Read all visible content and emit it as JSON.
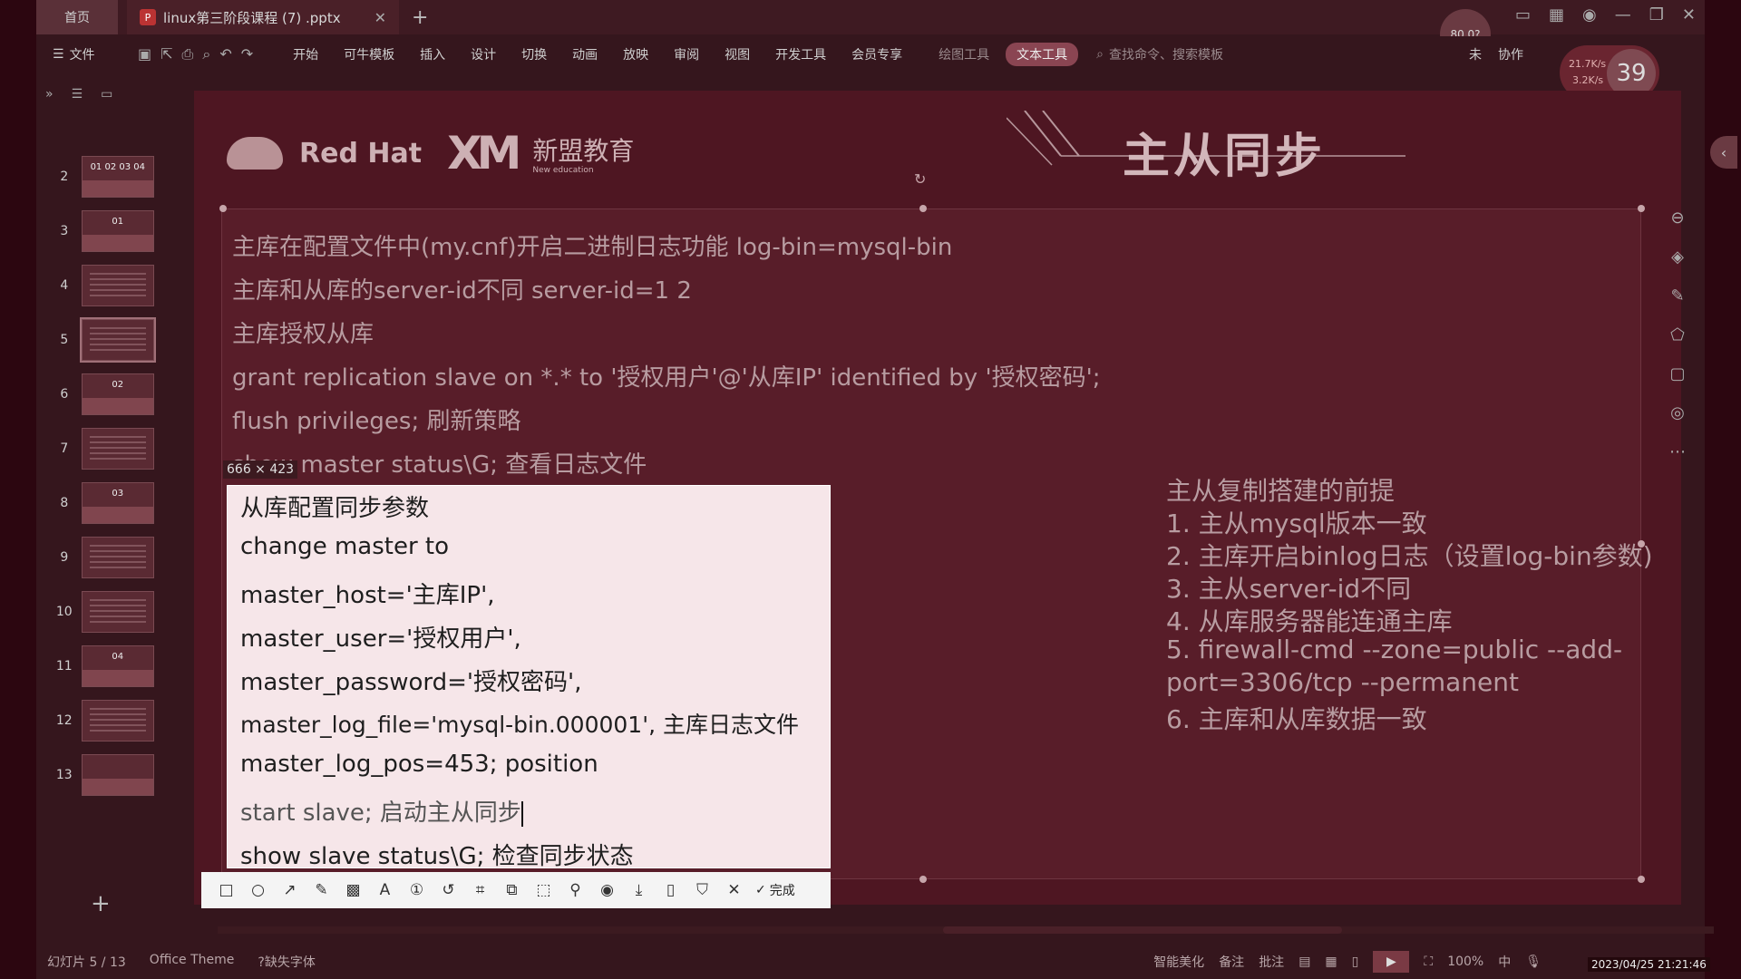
{
  "titlebar": {
    "home_tab": "首页",
    "doc_tab": "linux第三阶段课程 (7) .pptx",
    "close": "✕",
    "plus": "+",
    "speed_text": "80.0?"
  },
  "menubar": {
    "file": "文件",
    "menu_items": [
      "开始",
      "可牛模板",
      "插入",
      "设计",
      "切换",
      "动画",
      "放映",
      "审阅",
      "视图",
      "开发工具",
      "会员专享"
    ],
    "drawing_tools": "绘图工具",
    "text_tools": "文本工具",
    "search": "查找命令、搜索模板",
    "right_items": [
      "未",
      "协作"
    ]
  },
  "perf": {
    "up": "21.7K/s",
    "down": "3.2K/s",
    "percent": "39"
  },
  "thumbnails": [
    {
      "num": "2",
      "caption": "01 02 03 04",
      "type": "toc"
    },
    {
      "num": "3",
      "caption": "01",
      "type": "section"
    },
    {
      "num": "4",
      "caption": "",
      "type": "text"
    },
    {
      "num": "5",
      "caption": "",
      "type": "text",
      "selected": true
    },
    {
      "num": "6",
      "caption": "02",
      "type": "section"
    },
    {
      "num": "7",
      "caption": "",
      "type": "text"
    },
    {
      "num": "8",
      "caption": "03",
      "type": "section"
    },
    {
      "num": "9",
      "caption": "",
      "type": "text"
    },
    {
      "num": "10",
      "caption": "",
      "type": "text"
    },
    {
      "num": "11",
      "caption": "04",
      "type": "section"
    },
    {
      "num": "12",
      "caption": "",
      "type": "text"
    },
    {
      "num": "13",
      "caption": "",
      "type": "section"
    }
  ],
  "slide": {
    "logo_redhat": "Red Hat",
    "logo_xm": "XM",
    "logo_edu": "新盟教育",
    "logo_edu_sub": "New education",
    "title": "主从同步",
    "lines": [
      "主库在配置文件中(my.cnf)开启二进制日志功能 log-bin=mysql-bin",
      "主库和从库的server-id不同 server-id=1 2",
      "主库授权从库",
      "grant replication slave on *.* to '授权用户'@'从库IP' identified by '授权密码';",
      "flush privileges;     刷新策略",
      "show master status\\G;   查看日志文件"
    ],
    "prereq_title": "主从复制搭建的前提",
    "prereqs": [
      "1. 主从mysql版本一致",
      "2. 主库开启binlog日志（设置log-bin参数)",
      "3. 主从server-id不同",
      "4. 从库服务器能连通主库",
      "5. firewall-cmd --zone=public --add-",
      "port=3306/tcp --permanent",
      "6. 主库和从库数据一致"
    ]
  },
  "capture": {
    "size_label": "666 × 423",
    "lines": [
      "从库配置同步参数",
      "change master to",
      "master_host='主库IP',",
      "master_user='授权用户',",
      "master_password='授权密码',",
      "master_log_file='mysql-bin.000001',   主库日志文件",
      "master_log_pos=453;   position",
      "start slave;   启动主从同步",
      "show slave status\\G;    检查同步状态"
    ],
    "toolbar_done": "完成"
  },
  "statusbar": {
    "slide_info": "幻灯片 5 / 13",
    "theme": "Office Theme",
    "missing_font": "缺失字体",
    "beautify": "智能美化",
    "notes": "备注",
    "comments": "批注",
    "zoom": "100%",
    "ime": "中",
    "datetime": "2023/04/25 21:21:46"
  }
}
